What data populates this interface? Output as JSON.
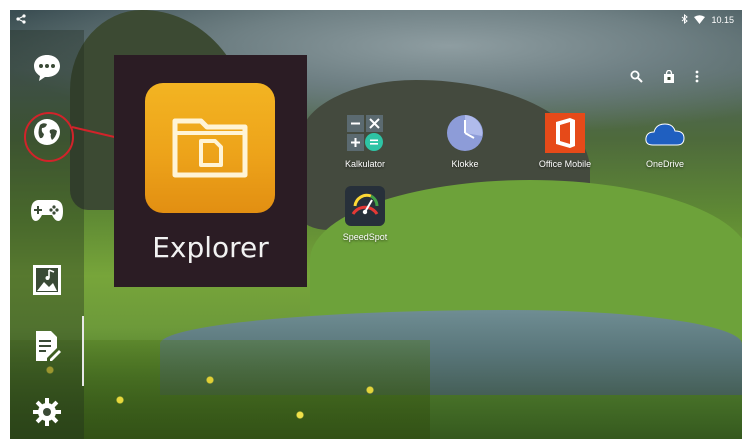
{
  "status_bar": {
    "left_icon": "share-icon",
    "icons": [
      "bluetooth-icon",
      "wifi-icon"
    ],
    "time": "10.15"
  },
  "sidebar": {
    "items": [
      {
        "name": "chat-icon"
      },
      {
        "name": "globe-icon",
        "highlighted": true
      },
      {
        "name": "gamepad-icon"
      },
      {
        "name": "music-gallery-icon"
      },
      {
        "name": "document-edit-icon"
      },
      {
        "name": "gear-icon"
      }
    ]
  },
  "explorer": {
    "label": "Explorer",
    "icon": "folder-document-icon",
    "color": "#EFA71C"
  },
  "top_actions": [
    "search-icon",
    "store-bag-icon",
    "more-vert-icon"
  ],
  "apps": [
    {
      "label": "Kalkulator",
      "icon": "calculator-icon"
    },
    {
      "label": "Klokke",
      "icon": "clock-icon"
    },
    {
      "label": "Office Mobile",
      "icon": "office-icon"
    },
    {
      "label": "OneDrive",
      "icon": "cloud-icon"
    },
    {
      "label": "SpeedSpot",
      "icon": "speedometer-icon"
    }
  ],
  "annotation_color": "#D2232A"
}
